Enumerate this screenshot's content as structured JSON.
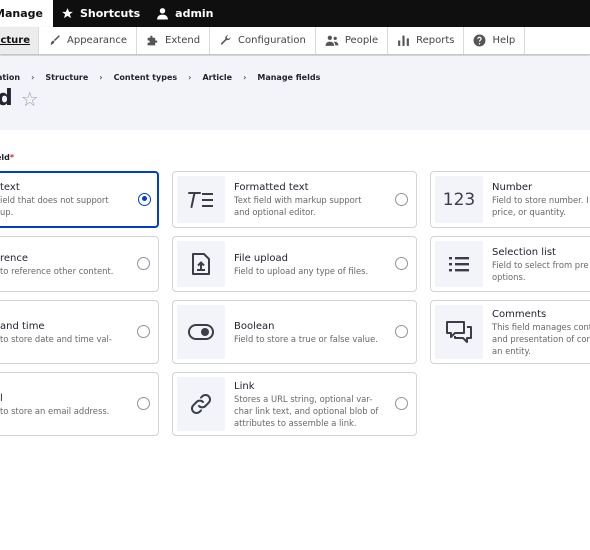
{
  "toolbar": {
    "manage_label": "Manage",
    "shortcuts_label": "Shortcuts",
    "user_label": "admin"
  },
  "tray": {
    "items": [
      {
        "label": "Structure",
        "icon": "structure-icon"
      },
      {
        "label": "Appearance",
        "icon": "paintbrush-icon"
      },
      {
        "label": "Extend",
        "icon": "puzzle-icon"
      },
      {
        "label": "Configuration",
        "icon": "wrench-icon"
      },
      {
        "label": "People",
        "icon": "people-icon"
      },
      {
        "label": "Reports",
        "icon": "bar-chart-icon"
      },
      {
        "label": "Help",
        "icon": "question-icon"
      }
    ]
  },
  "breadcrumb": [
    "ration",
    "Structure",
    "Content types",
    "Article",
    "Manage fields"
  ],
  "page": {
    "title": "d",
    "star": "☆"
  },
  "field_group": {
    "label": "eld",
    "required_mark": "*"
  },
  "cards": [
    {
      "key": "plain-text",
      "title": " text",
      "desc": [
        "ield that does not support",
        "up."
      ],
      "icon": "",
      "selected": true
    },
    {
      "key": "formatted-text",
      "title": "Formatted text",
      "desc": [
        "Text field with markup support",
        "and optional editor."
      ],
      "icon": "formatted-text-icon",
      "selected": false
    },
    {
      "key": "number",
      "title": "Number",
      "desc": [
        "Field to store number. I",
        "price, or quantity."
      ],
      "icon": "number-icon",
      "glyph": "123",
      "selected": false
    },
    {
      "key": "reference",
      "title": "rence",
      "desc": [
        "to reference other content."
      ],
      "icon": "",
      "selected": false
    },
    {
      "key": "file-upload",
      "title": "File upload",
      "desc": [
        "Field to upload any type of files."
      ],
      "icon": "file-upload-icon",
      "selected": false
    },
    {
      "key": "selection-list",
      "title": "Selection list",
      "desc": [
        "Field to select from pre",
        "options."
      ],
      "icon": "list-icon",
      "selected": false
    },
    {
      "key": "date-time",
      "title": " and time",
      "desc": [
        "to store date and time val-"
      ],
      "icon": "",
      "selected": false
    },
    {
      "key": "boolean",
      "title": "Boolean",
      "desc": [
        "Field to store a true or false value."
      ],
      "icon": "toggle-icon",
      "selected": false
    },
    {
      "key": "comments",
      "title": "Comments",
      "desc": [
        "This field manages cont",
        "and presentation of con",
        "an entity."
      ],
      "icon": "comments-icon",
      "selected": false
    },
    {
      "key": "email",
      "title": "l",
      "desc": [
        "to store an email address."
      ],
      "icon": "",
      "selected": false
    },
    {
      "key": "link",
      "title": "Link",
      "desc": [
        "Stores a URL string, optional var-",
        "char link text, and optional blob of",
        "attributes to assemble a link."
      ],
      "icon": "link-icon",
      "selected": false
    }
  ],
  "colors": {
    "accent": "#003ecc",
    "required": "#d72222",
    "toolbar_bg": "#0f0f0f",
    "header_bg": "#f3f4f9"
  }
}
